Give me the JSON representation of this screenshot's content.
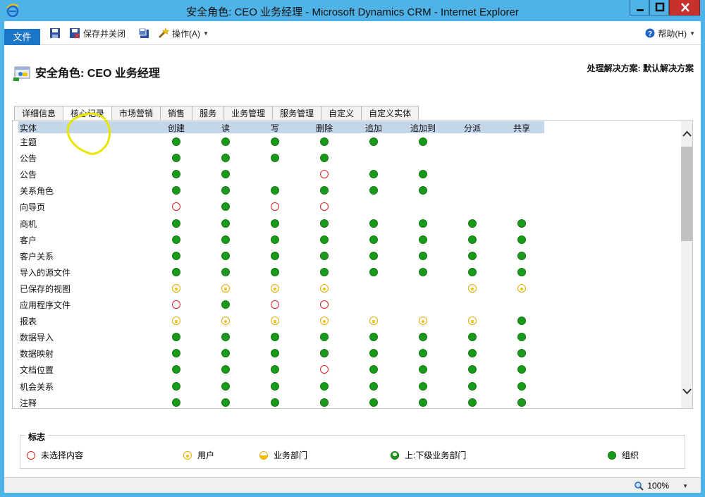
{
  "window": {
    "title": "安全角色: CEO 业务经理 - Microsoft Dynamics CRM - Internet Explorer"
  },
  "ribbon": {
    "file_label": "文件",
    "save_close_label": "保存并关闭",
    "actions_label": "操作(A)",
    "help_label": "帮助(H)"
  },
  "header": {
    "title": "安全角色: CEO 业务经理",
    "solution": "处理解决方案: 默认解决方案"
  },
  "tabs": [
    {
      "label": "详细信息",
      "active": false
    },
    {
      "label": "核心记录",
      "active": true
    },
    {
      "label": "市场营销",
      "active": false
    },
    {
      "label": "销售",
      "active": false
    },
    {
      "label": "服务",
      "active": false
    },
    {
      "label": "业务管理",
      "active": false
    },
    {
      "label": "服务管理",
      "active": false
    },
    {
      "label": "自定义",
      "active": false
    },
    {
      "label": "自定义实体",
      "active": false
    }
  ],
  "grid": {
    "entity_header": "实体",
    "columns": [
      "创建",
      "读",
      "写",
      "删除",
      "追加",
      "追加到",
      "分派",
      "共享"
    ],
    "rows": [
      {
        "entity": "主题",
        "levels": [
          "org",
          "org",
          "org",
          "org",
          "org",
          "org",
          "",
          ""
        ]
      },
      {
        "entity": "公告",
        "levels": [
          "org",
          "org",
          "org",
          "org",
          "",
          "",
          "",
          ""
        ]
      },
      {
        "entity": "公告",
        "levels": [
          "org",
          "org",
          "",
          "none",
          "org",
          "org",
          "",
          ""
        ]
      },
      {
        "entity": "关系角色",
        "levels": [
          "org",
          "org",
          "org",
          "org",
          "org",
          "org",
          "",
          ""
        ]
      },
      {
        "entity": "向导页",
        "levels": [
          "none",
          "org",
          "none",
          "none",
          "",
          "",
          "",
          ""
        ]
      },
      {
        "entity": "商机",
        "levels": [
          "org",
          "org",
          "org",
          "org",
          "org",
          "org",
          "org",
          "org"
        ]
      },
      {
        "entity": "客户",
        "levels": [
          "org",
          "org",
          "org",
          "org",
          "org",
          "org",
          "org",
          "org"
        ]
      },
      {
        "entity": "客户关系",
        "levels": [
          "org",
          "org",
          "org",
          "org",
          "org",
          "org",
          "org",
          "org"
        ]
      },
      {
        "entity": "导入的源文件",
        "levels": [
          "org",
          "org",
          "org",
          "org",
          "org",
          "org",
          "org",
          "org"
        ]
      },
      {
        "entity": "已保存的视图",
        "levels": [
          "user",
          "user",
          "user",
          "user",
          "",
          "",
          "user",
          "user"
        ]
      },
      {
        "entity": "应用程序文件",
        "levels": [
          "none",
          "org",
          "none",
          "none",
          "",
          "",
          "",
          ""
        ]
      },
      {
        "entity": "报表",
        "levels": [
          "user",
          "user",
          "user",
          "user",
          "user",
          "user",
          "user",
          "org"
        ]
      },
      {
        "entity": "数据导入",
        "levels": [
          "org",
          "org",
          "org",
          "org",
          "org",
          "org",
          "org",
          "org"
        ]
      },
      {
        "entity": "数据映射",
        "levels": [
          "org",
          "org",
          "org",
          "org",
          "org",
          "org",
          "org",
          "org"
        ]
      },
      {
        "entity": "文档位置",
        "levels": [
          "org",
          "org",
          "org",
          "none",
          "org",
          "org",
          "org",
          "org"
        ]
      },
      {
        "entity": "机会关系",
        "levels": [
          "org",
          "org",
          "org",
          "org",
          "org",
          "org",
          "org",
          "org"
        ]
      },
      {
        "entity": "注释",
        "levels": [
          "org",
          "org",
          "org",
          "org",
          "org",
          "org",
          "org",
          "org"
        ]
      }
    ]
  },
  "legend": {
    "title": "标志",
    "items": [
      {
        "key": "none",
        "label": "未选择内容"
      },
      {
        "key": "user",
        "label": "用户"
      },
      {
        "key": "bu",
        "label": "业务部门"
      },
      {
        "key": "parent",
        "label": "上:下级业务部门"
      },
      {
        "key": "org",
        "label": "组织"
      }
    ]
  },
  "statusbar": {
    "zoom": "100%"
  },
  "colors": {
    "org": "#1a9a1a",
    "none": "#dd2222",
    "user": "#f2c200",
    "accent": "#1c76c7",
    "titlebar": "#4fb3e8"
  }
}
